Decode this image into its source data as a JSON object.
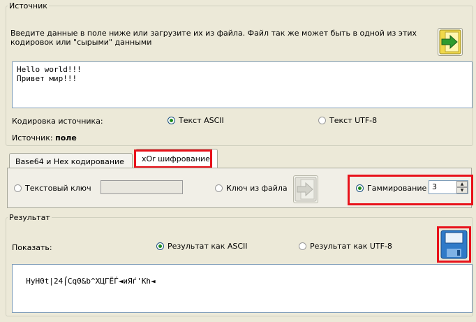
{
  "source": {
    "legend": "Источник",
    "description": "Введите данные в поле ниже или загрузите их из файла. Файл так же может быть в одной из этих кодировок или \"сырыми\" данными",
    "text_line1": "Hello world!!!",
    "text_line2": "Привет мир!!!",
    "encoding_label": "Кодировка источника:",
    "option_ascii": "Текст ASCII",
    "option_utf8": "Текст UTF-8",
    "selected": "ascii",
    "source_label": "Источник:",
    "source_value": "поле",
    "load_icon": "load-file-icon"
  },
  "tabs": [
    {
      "label": "Base64 и Hex кодирование",
      "active": false
    },
    {
      "label": "xOr шифрование",
      "active": true
    }
  ],
  "xor": {
    "text_key_label": "Текстовый ключ",
    "text_key_value": "",
    "file_key_label": "Ключ из файла",
    "gamma_label": "Гаммирование",
    "gamma_value": "3",
    "selected": "gamma"
  },
  "result": {
    "legend": "Результат",
    "show_label": "Показать:",
    "option_ascii": "Результат как ASCII",
    "option_utf8": "Результат как UTF-8",
    "selected": "ascii",
    "output_text": "HyH0t|24⌠Cq0&b^ХЦГЁЃ◄иЯѓ'Kh◄",
    "save_icon": "floppy-disk-icon"
  },
  "colors": {
    "highlight": "#e8121b",
    "window_bg": "#ece9d8",
    "radio_selected": "#1d8a1d",
    "load_icon_bg": "#f0d84a",
    "load_icon_arrow": "#2e9b2e",
    "save_icon": "#2f7ac8"
  }
}
